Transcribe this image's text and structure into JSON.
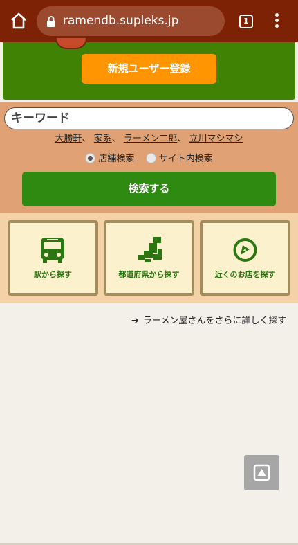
{
  "browser": {
    "url": "ramendb.supleks.jp",
    "tab_count": "1",
    "home_icon": "home-icon",
    "lock_icon": "lock-icon",
    "menu_icon": "more-vert-icon"
  },
  "banner": {
    "register_label": "新規ユーザー登録",
    "colors": {
      "banner": "#3f8204",
      "register": "#ff9500"
    }
  },
  "search": {
    "placeholder": "キーワード",
    "suggestions": [
      "大勝軒",
      "家系",
      "ラーメン二郎",
      "立川マシマシ"
    ],
    "separator": "、",
    "modes": [
      {
        "label": "店舗検索",
        "selected": true
      },
      {
        "label": "サイト内検索",
        "selected": false
      }
    ],
    "submit_label": "検索する"
  },
  "categories": [
    {
      "label": "駅から探す",
      "icon": "bus-icon"
    },
    {
      "label": "都道府県から探す",
      "icon": "japan-map-icon"
    },
    {
      "label": "近くのお店を探す",
      "icon": "location-icon"
    }
  ],
  "more": {
    "label": "ラーメン屋さんをさらに詳しく探す",
    "icon": "arrow-right-icon"
  },
  "back_to_top_icon": "arrow-up-icon"
}
